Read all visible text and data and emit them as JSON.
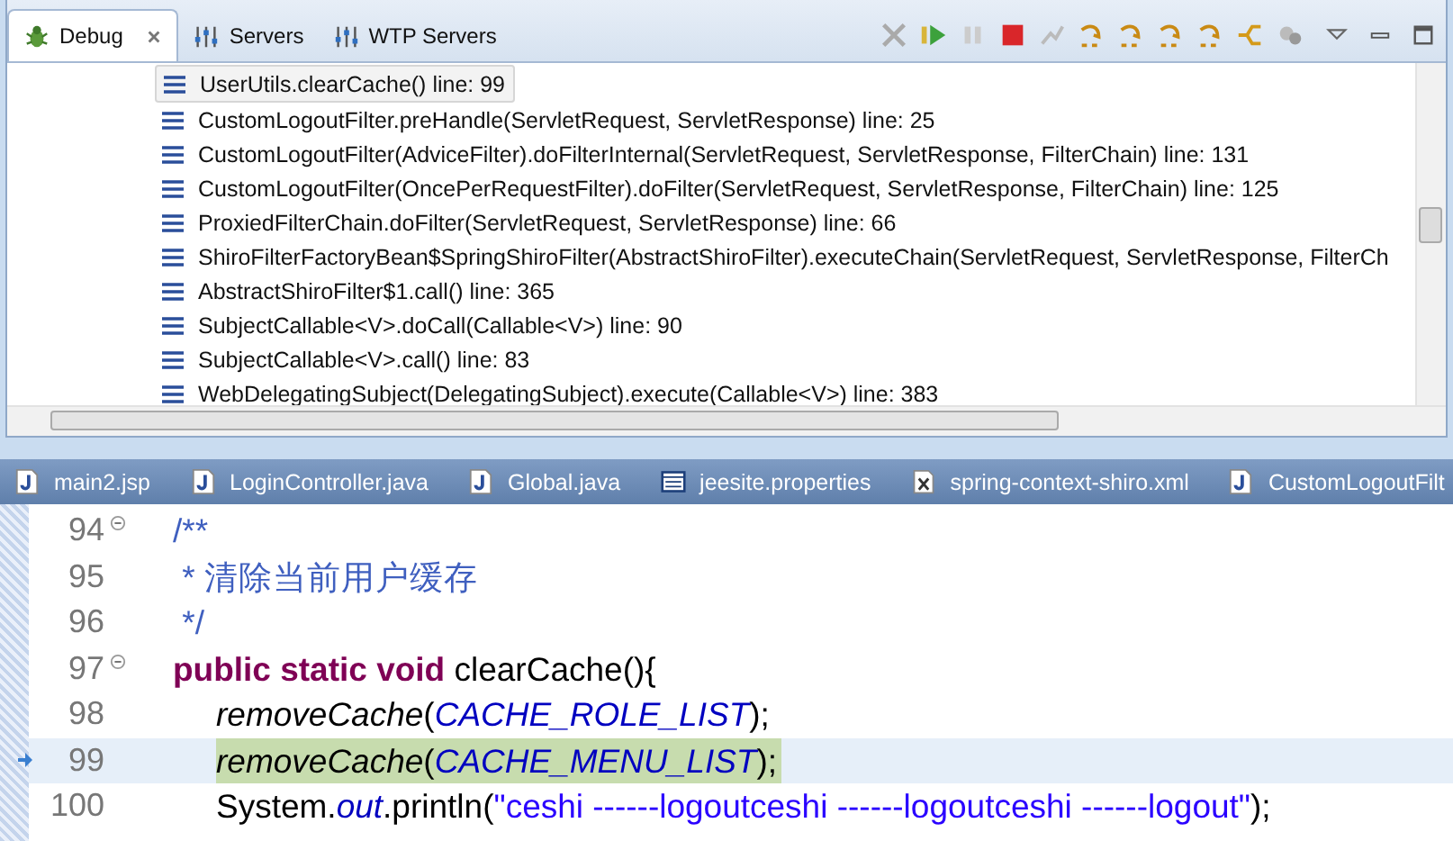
{
  "debug_view": {
    "tabs": [
      {
        "label": "Debug",
        "selected": true,
        "closable": true,
        "kind": "bug"
      },
      {
        "label": "Servers",
        "selected": false,
        "closable": false,
        "kind": "servers"
      },
      {
        "label": "WTP Servers",
        "selected": false,
        "closable": false,
        "kind": "servers"
      }
    ],
    "stack_frames": [
      {
        "text": "UserUtils.clearCache() line: 99",
        "selected": true
      },
      {
        "text": "CustomLogoutFilter.preHandle(ServletRequest, ServletResponse) line: 25",
        "selected": false
      },
      {
        "text": "CustomLogoutFilter(AdviceFilter).doFilterInternal(ServletRequest, ServletResponse, FilterChain) line: 131",
        "selected": false
      },
      {
        "text": "CustomLogoutFilter(OncePerRequestFilter).doFilter(ServletRequest, ServletResponse, FilterChain) line: 125",
        "selected": false
      },
      {
        "text": "ProxiedFilterChain.doFilter(ServletRequest, ServletResponse) line: 66",
        "selected": false
      },
      {
        "text": "ShiroFilterFactoryBean$SpringShiroFilter(AbstractShiroFilter).executeChain(ServletRequest, ServletResponse, FilterCh",
        "selected": false
      },
      {
        "text": "AbstractShiroFilter$1.call() line: 365",
        "selected": false
      },
      {
        "text": "SubjectCallable<V>.doCall(Callable<V>) line: 90",
        "selected": false
      },
      {
        "text": "SubjectCallable<V>.call() line: 83",
        "selected": false
      },
      {
        "text": "WebDelegatingSubject(DelegatingSubject).execute(Callable<V>) line: 383",
        "selected": false
      }
    ]
  },
  "editor": {
    "tabs": [
      {
        "label": "main2.jsp",
        "kind": "jsp"
      },
      {
        "label": "LoginController.java",
        "kind": "java"
      },
      {
        "label": "Global.java",
        "kind": "java"
      },
      {
        "label": "jeesite.properties",
        "kind": "properties"
      },
      {
        "label": "spring-context-shiro.xml",
        "kind": "xml"
      },
      {
        "label": "CustomLogoutFilt",
        "kind": "java"
      }
    ],
    "lines": [
      {
        "number": "94",
        "foldable": true,
        "current": false,
        "kind": "member",
        "tokens": [
          {
            "text": "/**",
            "kind": "comment"
          }
        ]
      },
      {
        "number": "95",
        "foldable": false,
        "current": false,
        "kind": "member",
        "tokens": [
          {
            "text": " * 清除当前用户缓存",
            "kind": "comment"
          }
        ]
      },
      {
        "number": "96",
        "foldable": false,
        "current": false,
        "kind": "member",
        "tokens": [
          {
            "text": " */",
            "kind": "comment"
          }
        ]
      },
      {
        "number": "97",
        "foldable": true,
        "current": false,
        "kind": "member",
        "tokens": [
          {
            "text": "public static void",
            "kind": "keyword"
          },
          {
            "text": " clearCache(){",
            "kind": "plain"
          }
        ]
      },
      {
        "number": "98",
        "foldable": false,
        "current": false,
        "kind": "statement",
        "tokens": [
          {
            "text": "removeCache",
            "kind": "method"
          },
          {
            "text": "(",
            "kind": "plain"
          },
          {
            "text": "CACHE_ROLE_LIST",
            "kind": "constant"
          },
          {
            "text": ");",
            "kind": "plain"
          }
        ]
      },
      {
        "number": "99",
        "foldable": false,
        "current": true,
        "kind": "statement",
        "tokens": [
          {
            "text": "removeCache",
            "kind": "method"
          },
          {
            "text": "(",
            "kind": "plain"
          },
          {
            "text": "CACHE_MENU_LIST",
            "kind": "constant"
          },
          {
            "text": ");",
            "kind": "plain"
          }
        ]
      },
      {
        "number": "100",
        "foldable": false,
        "current": false,
        "kind": "statement",
        "tokens": [
          {
            "text": "System.",
            "kind": "plain"
          },
          {
            "text": "out",
            "kind": "constant"
          },
          {
            "text": ".println(",
            "kind": "plain"
          },
          {
            "text": "\"ceshi ------logoutceshi ------logoutceshi ------logout\"",
            "kind": "string"
          },
          {
            "text": ");",
            "kind": "plain"
          }
        ]
      }
    ]
  }
}
